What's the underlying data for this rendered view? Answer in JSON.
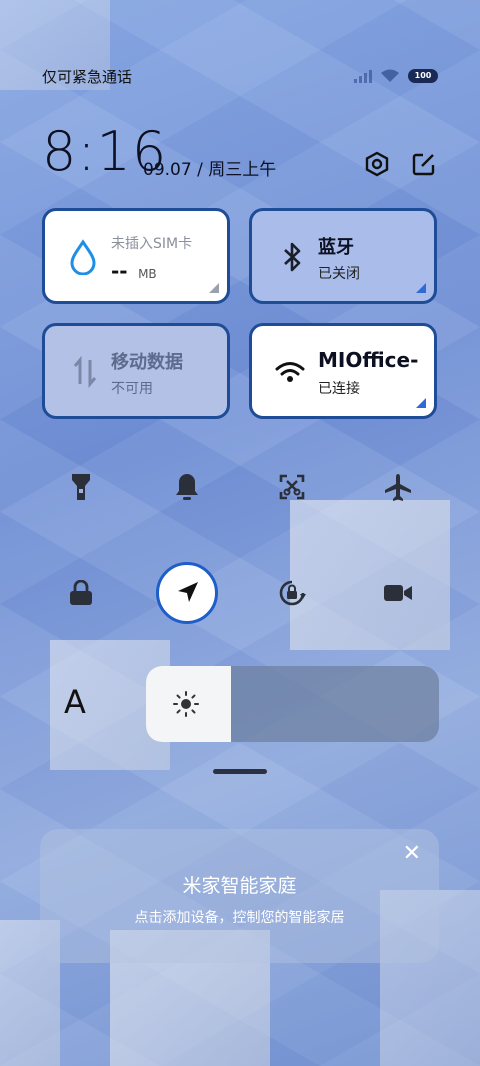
{
  "status_bar": {
    "carrier": "仅可紧急通话",
    "battery": "100"
  },
  "header": {
    "time": "8:16",
    "date": "09.07 / 周三上午"
  },
  "tiles": {
    "data": {
      "title": "未插入SIM卡",
      "value": "--",
      "unit": "MB"
    },
    "bluetooth": {
      "title": "蓝牙",
      "status": "已关闭"
    },
    "mobile_data": {
      "title": "移动数据",
      "status": "不可用"
    },
    "wifi": {
      "title": "MIOffice-",
      "status": "已连接"
    }
  },
  "brightness": {
    "font_label": "A",
    "level_percent": 29
  },
  "mijia_card": {
    "title": "米家智能家庭",
    "subtitle": "点击添加设备，控制您的智能家居",
    "close": "✕"
  },
  "icons": {
    "row1": [
      "flashlight-icon",
      "bell-icon",
      "screenshot-icon",
      "airplane-icon"
    ],
    "row2": [
      "lock-icon",
      "location-icon",
      "auto-rotate-icon",
      "video-camera-icon"
    ]
  },
  "colors": {
    "accent": "#1e5ec8",
    "tile_border": "#1e4c96",
    "tile_active_blue": "#a9bcea"
  }
}
